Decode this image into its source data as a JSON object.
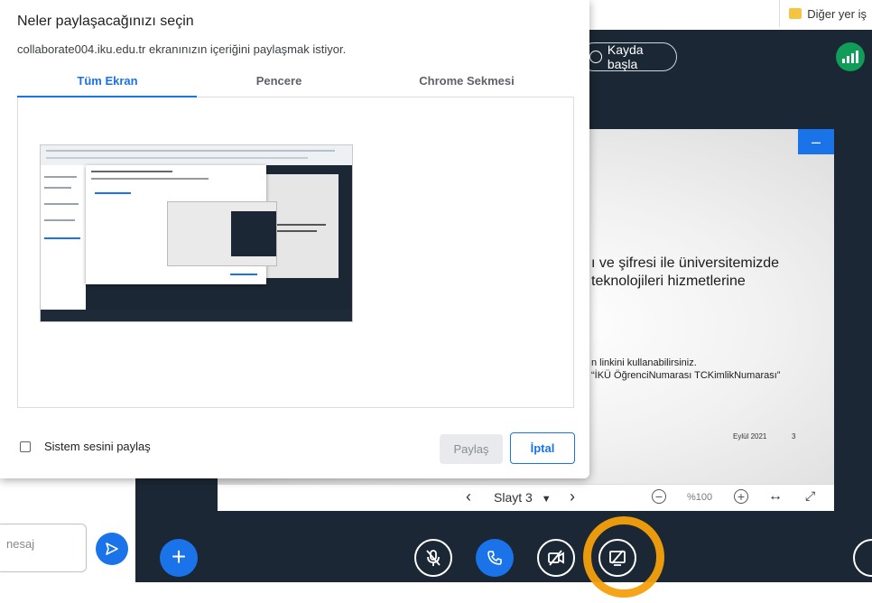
{
  "browser": {
    "bookmark_label": "Diğer yer iş"
  },
  "meeting": {
    "record_label": "Kayda başla",
    "slide": {
      "line1": "ı ve şifresi ile üniversitemizde",
      "line2": "teknolojileri hizmetlerine",
      "line3": "n linkini kullanabilirsiniz.",
      "line4": "“İKÜ ÖğrenciNumarası TCKimlikNumarası”",
      "date": "Eylül 2021",
      "page": "3"
    },
    "slide_toolbar": {
      "slide_label": "Slayt 3",
      "zoom": "%100"
    },
    "chat_placeholder": "nesaj"
  },
  "dialog": {
    "title": "Neler paylaşacağınızı seçin",
    "subtitle": "collaborate004.iku.edu.tr ekranınızın içeriğini paylaşmak istiyor.",
    "tabs": [
      {
        "label": "Tüm Ekran"
      },
      {
        "label": "Pencere"
      },
      {
        "label": "Chrome Sekmesi"
      }
    ],
    "system_audio_label": "Sistem sesini paylaş",
    "share_label": "Paylaş",
    "cancel_label": "İptal"
  },
  "colors": {
    "accent": "#1a73e8",
    "dark_bg": "#1b2734",
    "highlight": "#f5a00c",
    "signal": "#0f9d58"
  }
}
